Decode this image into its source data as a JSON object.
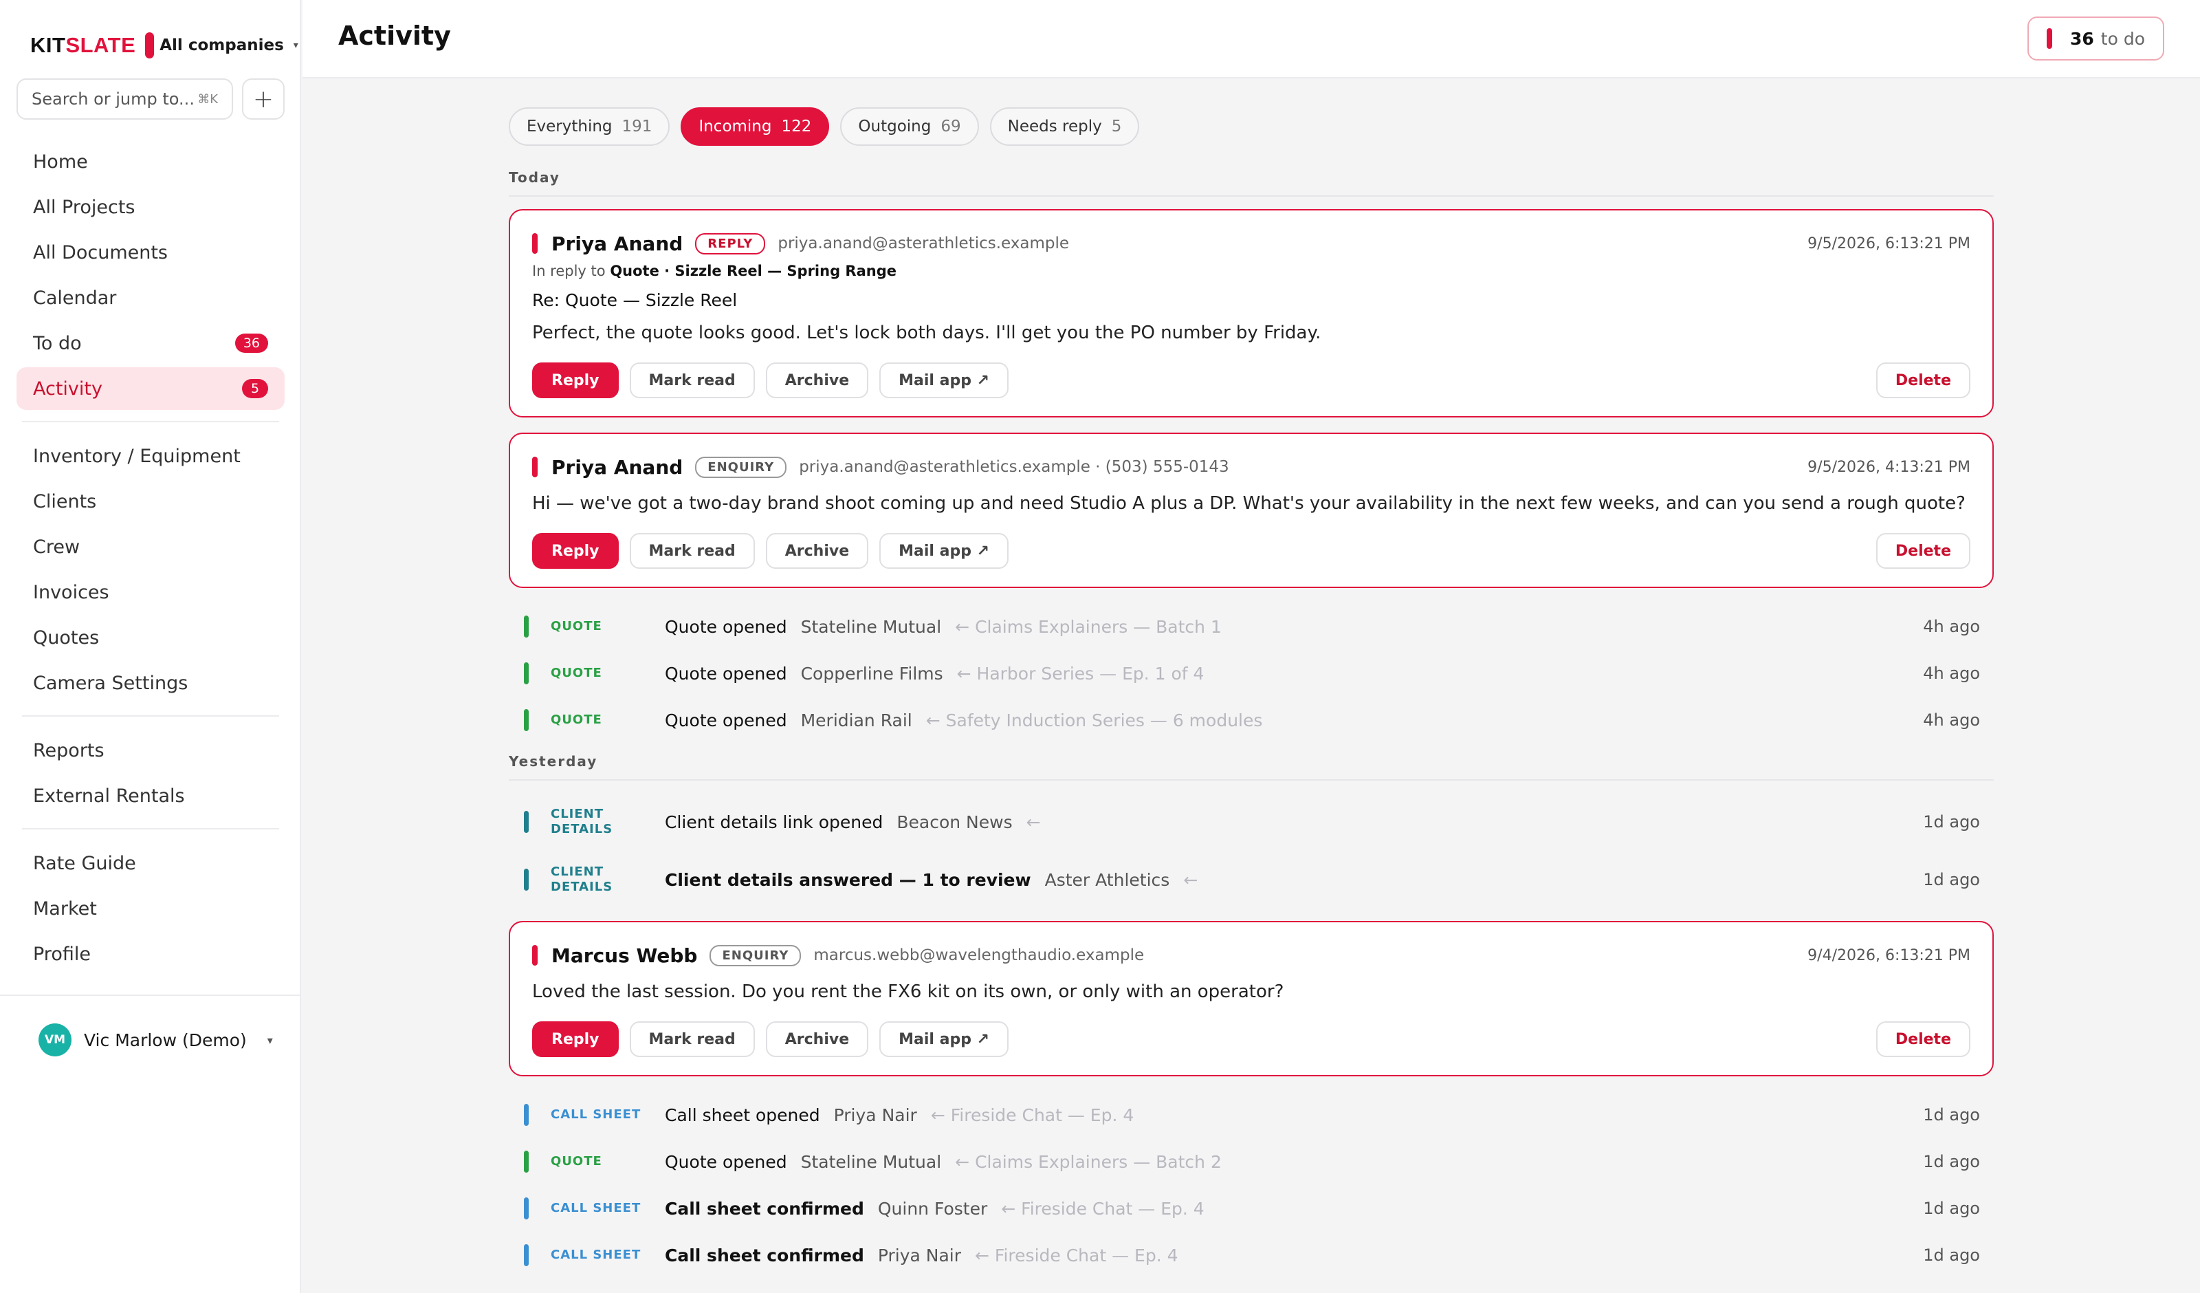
{
  "brand": {
    "logo_kit": "KIT",
    "logo_slate": "SLATE",
    "company": "All companies"
  },
  "search": {
    "placeholder": "Search or jump to...",
    "shortcut": "⌘K",
    "add_icon": "plus-icon"
  },
  "nav": {
    "group1": [
      {
        "label": "Home"
      },
      {
        "label": "All Projects"
      },
      {
        "label": "All Documents"
      },
      {
        "label": "Calendar"
      },
      {
        "label": "To do",
        "badge": "36"
      },
      {
        "label": "Activity",
        "badge": "5",
        "active": true
      }
    ],
    "group2": [
      {
        "label": "Inventory / Equipment"
      },
      {
        "label": "Clients"
      },
      {
        "label": "Crew"
      },
      {
        "label": "Invoices"
      },
      {
        "label": "Quotes"
      },
      {
        "label": "Camera Settings"
      }
    ],
    "group3": [
      {
        "label": "Reports"
      },
      {
        "label": "External Rentals"
      }
    ],
    "group4": [
      {
        "label": "Rate Guide"
      },
      {
        "label": "Market"
      },
      {
        "label": "Profile"
      }
    ]
  },
  "user": {
    "initials": "VM",
    "name": "Vic Marlow (Demo)"
  },
  "header": {
    "title": "Activity",
    "todo_count": "36",
    "todo_label": "to do"
  },
  "filters": [
    {
      "label": "Everything",
      "count": "191"
    },
    {
      "label": "Incoming",
      "count": "122",
      "active": true
    },
    {
      "label": "Outgoing",
      "count": "69"
    },
    {
      "label": "Needs reply",
      "count": "5"
    }
  ],
  "sections": {
    "today": "Today",
    "yesterday": "Yesterday"
  },
  "actions": {
    "reply": "Reply",
    "mark_read": "Mark read",
    "archive": "Archive",
    "mail_app": "Mail app ↗",
    "delete": "Delete"
  },
  "cards": [
    {
      "name": "Priya Anand",
      "tag": "REPLY",
      "email": "priya.anand@asterathletics.example",
      "time": "9/5/2026, 6:13:21 PM",
      "reply_prefix": "In reply to",
      "reply_target": "Quote · Sizzle Reel — Spring Range",
      "subject": "Re: Quote — Sizzle Reel",
      "body": "Perfect, the quote looks good. Let's lock both days. I'll get you the PO number by Friday."
    },
    {
      "name": "Priya Anand",
      "tag": "ENQUIRY",
      "email": "priya.anand@asterathletics.example · (503) 555-0143",
      "time": "9/5/2026, 4:13:21 PM",
      "body": "Hi — we've got a two-day brand shoot coming up and need Studio A plus a DP. What's your availability in the next few weeks, and can you send a rough quote?"
    },
    {
      "name": "Marcus Webb",
      "tag": "ENQUIRY",
      "email": "marcus.webb@wavelengthaudio.example",
      "time": "9/4/2026, 6:13:21 PM",
      "body": "Loved the last session. Do you rent the FX6 kit on its own, or only with an operator?"
    }
  ],
  "today_rows": [
    {
      "kind": "QUOTE",
      "what": "Quote opened",
      "who": "Stateline Mutual",
      "ctx": "← Claims Explainers — Batch 1",
      "ago": "4h ago"
    },
    {
      "kind": "QUOTE",
      "what": "Quote opened",
      "who": "Copperline Films",
      "ctx": "← Harbor Series — Ep. 1 of 4",
      "ago": "4h ago"
    },
    {
      "kind": "QUOTE",
      "what": "Quote opened",
      "who": "Meridian Rail",
      "ctx": "← Safety Induction Series — 6 modules",
      "ago": "4h ago"
    }
  ],
  "yesterday_rows": [
    {
      "kind_1": "CLIENT",
      "kind_2": "DETAILS",
      "what": "Client details link opened",
      "who": "Beacon News",
      "ctx": "←",
      "ago": "1d ago"
    },
    {
      "kind_1": "CLIENT",
      "kind_2": "DETAILS",
      "what": "Client details answered — 1 to review",
      "who": "Aster Athletics",
      "ctx": "←",
      "ago": "1d ago"
    }
  ],
  "later_rows": [
    {
      "kind": "CALL SHEET",
      "what": "Call sheet opened",
      "who": "Priya Nair",
      "ctx": "← Fireside Chat — Ep. 4",
      "ago": "1d ago"
    },
    {
      "kind": "QUOTE",
      "what": "Quote opened",
      "who": "Stateline Mutual",
      "ctx": "← Claims Explainers — Batch 2",
      "ago": "1d ago"
    },
    {
      "kind": "CALL SHEET",
      "what": "Call sheet confirmed",
      "who": "Quinn Foster",
      "ctx": "← Fireside Chat — Ep. 4",
      "ago": "1d ago"
    },
    {
      "kind": "CALL SHEET",
      "what": "Call sheet confirmed",
      "who": "Priya Nair",
      "ctx": "← Fireside Chat — Ep. 4",
      "ago": "1d ago"
    }
  ],
  "colors": {
    "accent": "#e1123c",
    "quote": "#2aa044",
    "client_details": "#1f7f8c",
    "call_sheet": "#3a8fd1"
  }
}
